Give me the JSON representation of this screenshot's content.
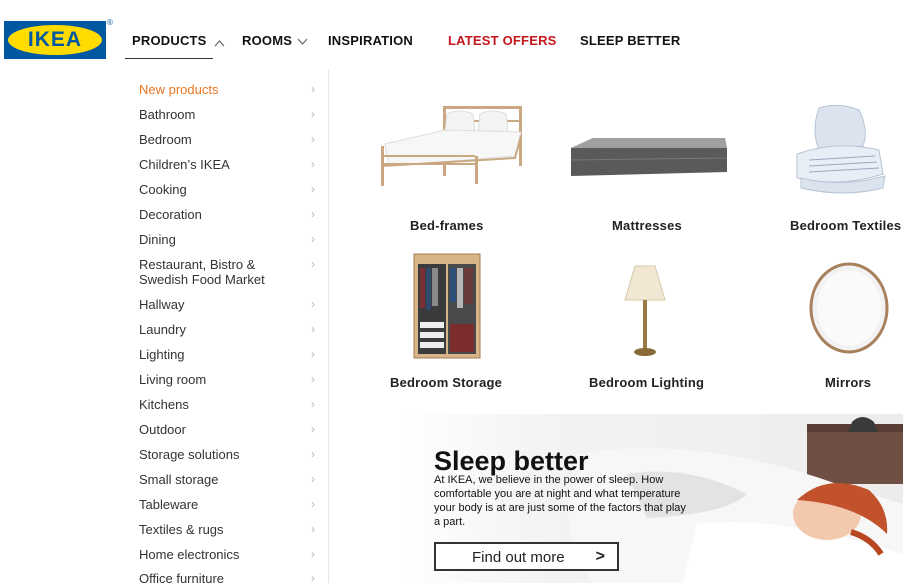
{
  "brand": {
    "logo_text": "IKEA",
    "registered": "®",
    "colors": {
      "blue": "#0058a3",
      "yellow": "#ffdb00",
      "offer_red": "#c4161c",
      "active_orange": "#e87722"
    }
  },
  "nav": {
    "products": "PRODUCTS",
    "rooms": "ROOMS",
    "inspiration": "INSPIRATION",
    "latest_offers": "LATEST OFFERS",
    "sleep_better": "SLEEP BETTER"
  },
  "sidebar": {
    "items": [
      {
        "label": "New products",
        "active": true
      },
      {
        "label": "Bathroom"
      },
      {
        "label": "Bedroom"
      },
      {
        "label": "Children’s IKEA"
      },
      {
        "label": "Cooking"
      },
      {
        "label": "Decoration"
      },
      {
        "label": "Dining"
      },
      {
        "label": "Restaurant, Bistro & Swedish Food Market"
      },
      {
        "label": "Hallway"
      },
      {
        "label": "Laundry"
      },
      {
        "label": "Lighting"
      },
      {
        "label": "Living room"
      },
      {
        "label": "Kitchens"
      },
      {
        "label": "Outdoor"
      },
      {
        "label": "Storage solutions"
      },
      {
        "label": "Small storage"
      },
      {
        "label": "Tableware"
      },
      {
        "label": "Textiles & rugs"
      },
      {
        "label": "Home electronics"
      },
      {
        "label": "Office furniture"
      }
    ],
    "arrow_icon": "chevron-right-icon"
  },
  "categories": [
    {
      "label": "Bed-frames",
      "icon": "bed-frame-image"
    },
    {
      "label": "Mattresses",
      "icon": "mattress-image"
    },
    {
      "label": "Bedroom Textiles",
      "icon": "bedroom-textiles-image"
    },
    {
      "label": "Bedroom Storage",
      "icon": "wardrobe-image"
    },
    {
      "label": "Bedroom Lighting",
      "icon": "table-lamp-image"
    },
    {
      "label": "Mirrors",
      "icon": "round-mirror-image"
    }
  ],
  "banner": {
    "title": "Sleep better",
    "text": "At IKEA, we believe in the power of sleep. How comfortable you are at night and what temperature your body is at are just some of the factors that play a part.",
    "cta_label": "Find out more",
    "cta_arrow": ">"
  }
}
